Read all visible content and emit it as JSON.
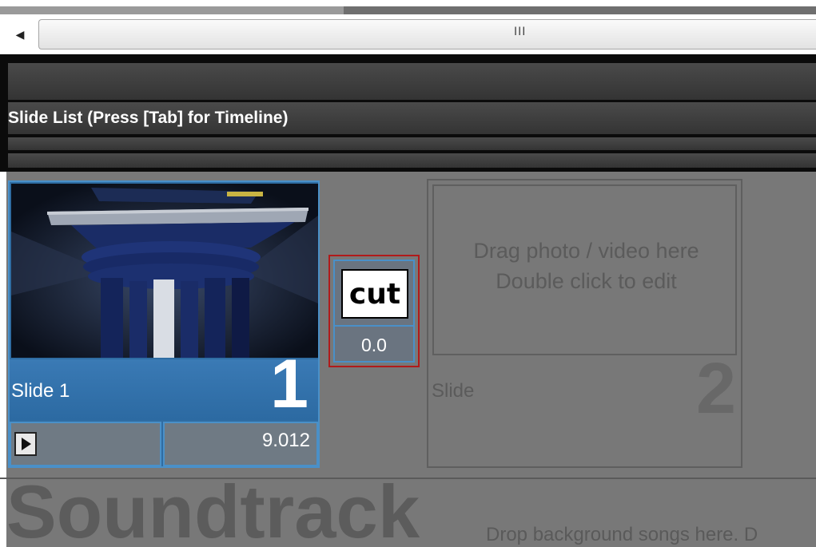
{
  "scrollbar": {
    "grip": "III"
  },
  "panel": {
    "title": "Slide List (Press [Tab] for Timeline)"
  },
  "slides": [
    {
      "label": "Slide 1",
      "number": "1",
      "duration": "9.012"
    },
    {
      "label": "Slide",
      "number": "2",
      "drop_hint_1": "Drag photo / video here",
      "drop_hint_2": "Double click to edit"
    }
  ],
  "transition": {
    "label": "cut",
    "duration": "0.0"
  },
  "soundtrack": {
    "title": "Soundtrack",
    "hint": "Drop background songs here.  D"
  },
  "colors": {
    "accent": "#4a90c8",
    "selection_red": "#b01a1a",
    "background": "#787878"
  }
}
